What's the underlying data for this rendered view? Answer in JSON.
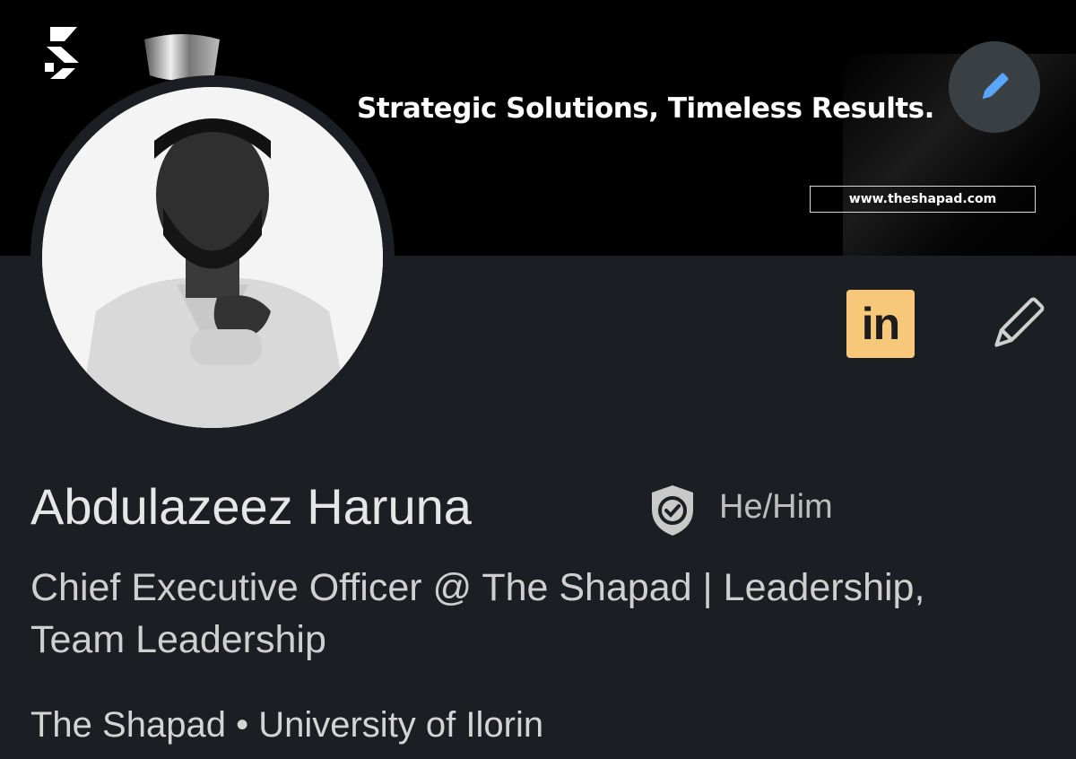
{
  "banner": {
    "tagline": "Strategic Solutions, Timeless Results.",
    "website": "www.theshapad.com",
    "logo_icon": "shapad-logo-icon",
    "edit_icon": "pencil-icon"
  },
  "profile": {
    "name": "Abdulazeez Haruna",
    "pronouns": "He/Him",
    "verified_icon": "shield-check-icon",
    "headline": "Chief Executive Officer @ The Shapad | Leadership, Team Leadership",
    "company": "The Shapad",
    "separator": "•",
    "school": "University of Ilorin",
    "badge_label": "in",
    "edit_icon": "pencil-icon"
  },
  "colors": {
    "background": "#1b1f23",
    "banner": "#000000",
    "badge": "#f7c77a",
    "edit_accent": "#5aa6ff"
  }
}
